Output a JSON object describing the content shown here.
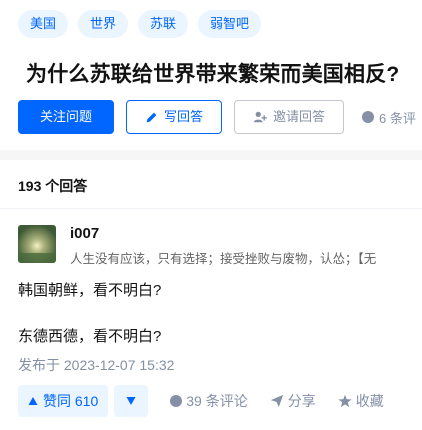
{
  "question": {
    "topics": [
      "美国",
      "世界",
      "苏联",
      "弱智吧"
    ],
    "title": "为什么苏联给世界带来繁荣而美国相反?",
    "follow_label": "关注问题",
    "write_answer_label": "写回答",
    "invite_label": "邀请回答",
    "views_text": "6 条评"
  },
  "answers_header": {
    "count_label": "193 个回答"
  },
  "answer": {
    "author_name": "i007",
    "author_bio": "人生没有应该，只有选择；接受挫败与废物，认怂；【无",
    "paragraphs": [
      "韩国朝鲜，看不明白?",
      "东德西德，看不明白?"
    ],
    "published": "发布于 2023-12-07 15:32",
    "vote_up_label": "赞同 610",
    "comments_label": "39 条评论",
    "share_label": "分享",
    "collect_label": "收藏"
  },
  "colors": {
    "accent": "#0066ff",
    "accent_bg": "#ebf5ff",
    "muted": "#8590a6"
  },
  "icons": {
    "write": "pencil-icon",
    "invite": "person-plus-icon",
    "comment": "speech-bubble-icon",
    "share": "paper-plane-icon",
    "collect": "star-icon",
    "vote_up": "triangle-up-icon",
    "vote_down": "triangle-down-icon"
  }
}
